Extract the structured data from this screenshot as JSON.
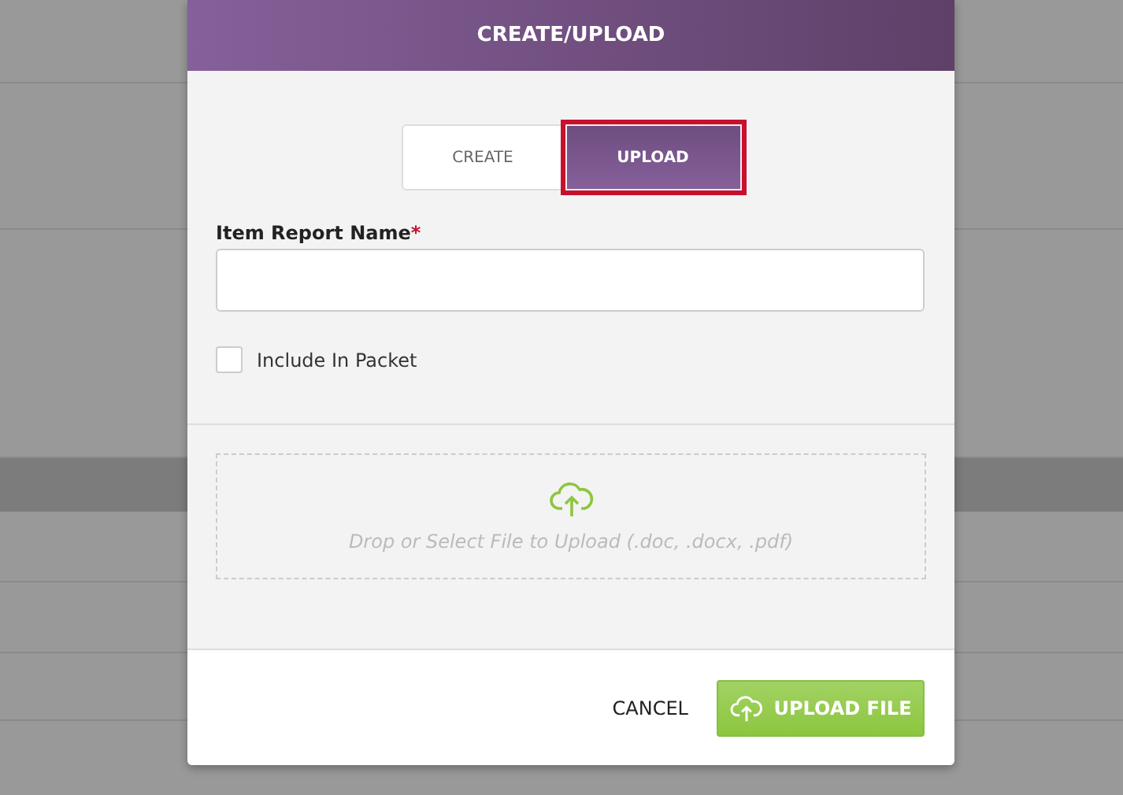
{
  "dialog": {
    "title": "CREATE/UPLOAD",
    "tabs": [
      {
        "label": "CREATE",
        "selected": false
      },
      {
        "label": "UPLOAD",
        "selected": true
      }
    ],
    "field": {
      "label": "Item Report Name",
      "required_mark": "*"
    },
    "checkbox": {
      "label": "Include In Packet",
      "checked": false
    },
    "dropzone": {
      "text": "Drop or Select File to Upload (.doc, .docx, .pdf)"
    },
    "buttons": [
      {
        "kind": "text",
        "label": "CANCEL"
      },
      {
        "kind": "primary",
        "label": "UPLOAD FILE"
      }
    ]
  }
}
